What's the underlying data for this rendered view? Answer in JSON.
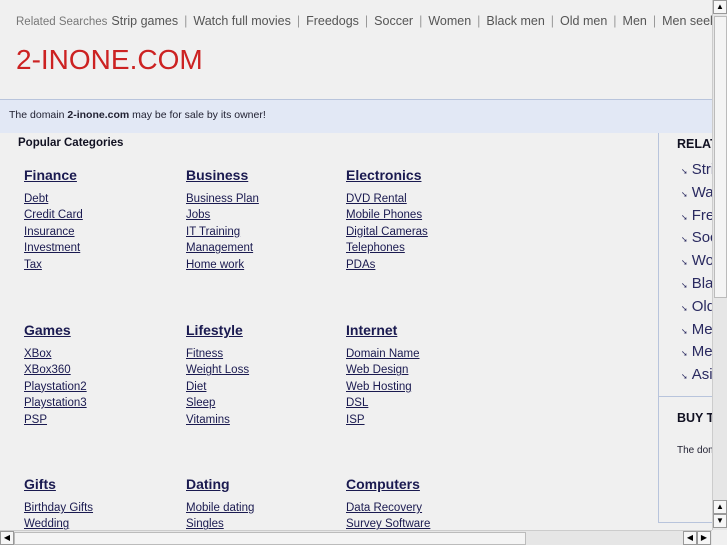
{
  "related_label": "Related Searches",
  "related": [
    "Strip games",
    "Watch full movies",
    "Freedogs",
    "Soccer",
    "Women",
    "Black men",
    "Old men",
    "Men",
    "Men seeking w"
  ],
  "logo": "2-INONE.COM",
  "sale": {
    "pre": "The domain ",
    "domain": "2-inone.com",
    "post": " may be for sale by its owner!"
  },
  "popular": "Popular Categories",
  "categories": [
    {
      "title": "Finance",
      "links": [
        "Debt",
        "Credit Card",
        "Insurance",
        "Investment",
        "Tax"
      ]
    },
    {
      "title": "Business",
      "links": [
        "Business Plan",
        "Jobs",
        "IT Training",
        "Management",
        "Home work"
      ]
    },
    {
      "title": "Electronics",
      "links": [
        "DVD Rental",
        "Mobile Phones",
        "Digital Cameras",
        "Telephones",
        "PDAs"
      ]
    },
    {
      "title": "Games",
      "links": [
        "XBox",
        "XBox360",
        "Playstation2",
        "Playstation3",
        "PSP"
      ]
    },
    {
      "title": "Lifestyle",
      "links": [
        "Fitness",
        "Weight Loss",
        "Diet",
        "Sleep",
        "Vitamins"
      ]
    },
    {
      "title": "Internet",
      "links": [
        "Domain Name",
        "Web Design",
        "Web Hosting",
        "DSL",
        "ISP"
      ]
    },
    {
      "title": "Gifts",
      "links": [
        "Birthday Gifts",
        "Wedding"
      ]
    },
    {
      "title": "Dating",
      "links": [
        "Mobile dating",
        "Singles"
      ]
    },
    {
      "title": "Computers",
      "links": [
        "Data Recovery",
        "Survey Software"
      ]
    }
  ],
  "right": {
    "title": "RELAT",
    "items": [
      "Stri",
      "Wa",
      "Fre",
      "Soc",
      "Wo",
      "Bla",
      "Old",
      "Mer",
      "Mer",
      "Asi"
    ],
    "buy_title": "BUY T",
    "buy_text": "The dom"
  }
}
